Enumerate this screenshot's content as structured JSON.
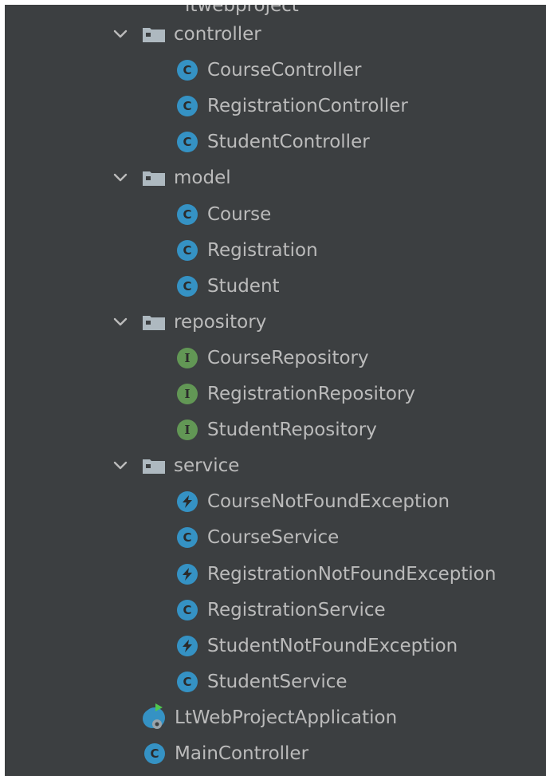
{
  "tree": {
    "clipped_top_text": "ltwebproject",
    "folders": [
      {
        "name": "controller",
        "children": [
          {
            "label": "CourseController",
            "kind": "class"
          },
          {
            "label": "RegistrationController",
            "kind": "class"
          },
          {
            "label": "StudentController",
            "kind": "class"
          }
        ]
      },
      {
        "name": "model",
        "children": [
          {
            "label": "Course",
            "kind": "class"
          },
          {
            "label": "Registration",
            "kind": "class"
          },
          {
            "label": "Student",
            "kind": "class"
          }
        ]
      },
      {
        "name": "repository",
        "children": [
          {
            "label": "CourseRepository",
            "kind": "interface"
          },
          {
            "label": "RegistrationRepository",
            "kind": "interface"
          },
          {
            "label": "StudentRepository",
            "kind": "interface"
          }
        ]
      },
      {
        "name": "service",
        "children": [
          {
            "label": "CourseNotFoundException",
            "kind": "exception"
          },
          {
            "label": "CourseService",
            "kind": "class"
          },
          {
            "label": "RegistrationNotFoundException",
            "kind": "exception"
          },
          {
            "label": "RegistrationService",
            "kind": "class"
          },
          {
            "label": "StudentNotFoundException",
            "kind": "exception"
          },
          {
            "label": "StudentService",
            "kind": "class"
          }
        ]
      }
    ],
    "root_items": [
      {
        "label": "LtWebProjectApplication",
        "kind": "application"
      },
      {
        "label": "MainController",
        "kind": "class"
      }
    ],
    "icon_letters": {
      "class": "C",
      "interface": "I"
    },
    "colors": {
      "background": "#3c3f41",
      "text": "#bbbbbb",
      "class_icon": "#3592c4",
      "interface_icon": "#629755",
      "folder_icon": "#aeb9c0",
      "run_marker": "#4fc74f"
    }
  }
}
